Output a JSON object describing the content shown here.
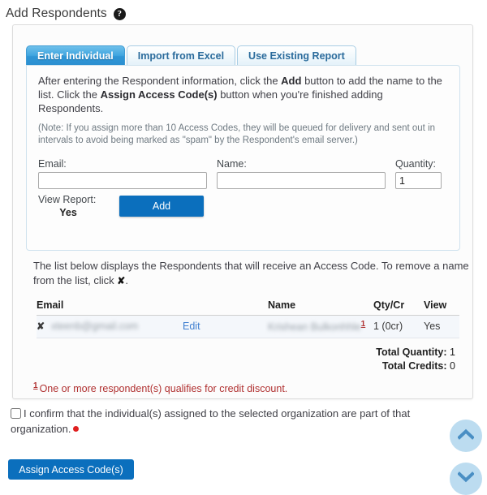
{
  "header": {
    "title": "Add Respondents",
    "help_icon": "question-mark-icon"
  },
  "tabs": [
    {
      "label": "Enter Individual",
      "active": true
    },
    {
      "label": "Import from Excel",
      "active": false
    },
    {
      "label": "Use Existing Report",
      "active": false
    }
  ],
  "panel": {
    "intro_pre": "After entering the Respondent information, click the ",
    "intro_bold1": "Add",
    "intro_mid": " button to add the name to the list. Click the ",
    "intro_bold2": "Assign Access Code(s)",
    "intro_post": " button when you're finished adding Respondents.",
    "note": "(Note: If you assign more than 10 Access Codes, they will be queued for delivery and sent out in intervals to avoid being marked as \"spam\" by the Respondent's email server.)",
    "fields": {
      "email_label": "Email:",
      "email_value": "",
      "email_placeholder": "",
      "name_label": "Name:",
      "name_value": "",
      "name_placeholder": "",
      "quantity_label": "Quantity:",
      "quantity_value": "1",
      "view_report_label": "View Report:",
      "view_report_value": "Yes",
      "add_button": "Add"
    }
  },
  "list": {
    "intro_pre": "The list below displays the Respondents that will receive an Access Code. To remove a name from the list, click ",
    "intro_x": "✘",
    "intro_post": ".",
    "columns": {
      "email": "Email",
      "name": "Name",
      "qty": "Qty/Cr",
      "view": "View"
    },
    "rows": [
      {
        "remove": "✘",
        "email": "xteenb@gmail.com",
        "edit": "Edit",
        "name": "Krishean Bulkonhhle",
        "name_footnote": "1",
        "qty": "1 (0cr)",
        "view": "Yes"
      }
    ],
    "totals": {
      "quantity_label": "Total Quantity:",
      "quantity_value": "1",
      "credits_label": "Total Credits:",
      "credits_value": "0"
    },
    "footnote_marker": "1",
    "footnote_text": "One or more respondent(s) qualifies for credit discount."
  },
  "confirm": {
    "checked": false,
    "text": "I confirm that the individual(s) assigned to the selected organization are part of that organization."
  },
  "actions": {
    "assign_button": "Assign Access Code(s)"
  },
  "scroll": {
    "up_icon": "chevron-up-icon",
    "down_icon": "chevron-down-icon"
  },
  "colors": {
    "accent_blue": "#0b6fbd",
    "tab_active": "#2f96d6",
    "link": "#3f7fd0",
    "required_red": "#e02020",
    "footnote_red": "#b03030",
    "scroll_circle": "#bcdcf0"
  }
}
